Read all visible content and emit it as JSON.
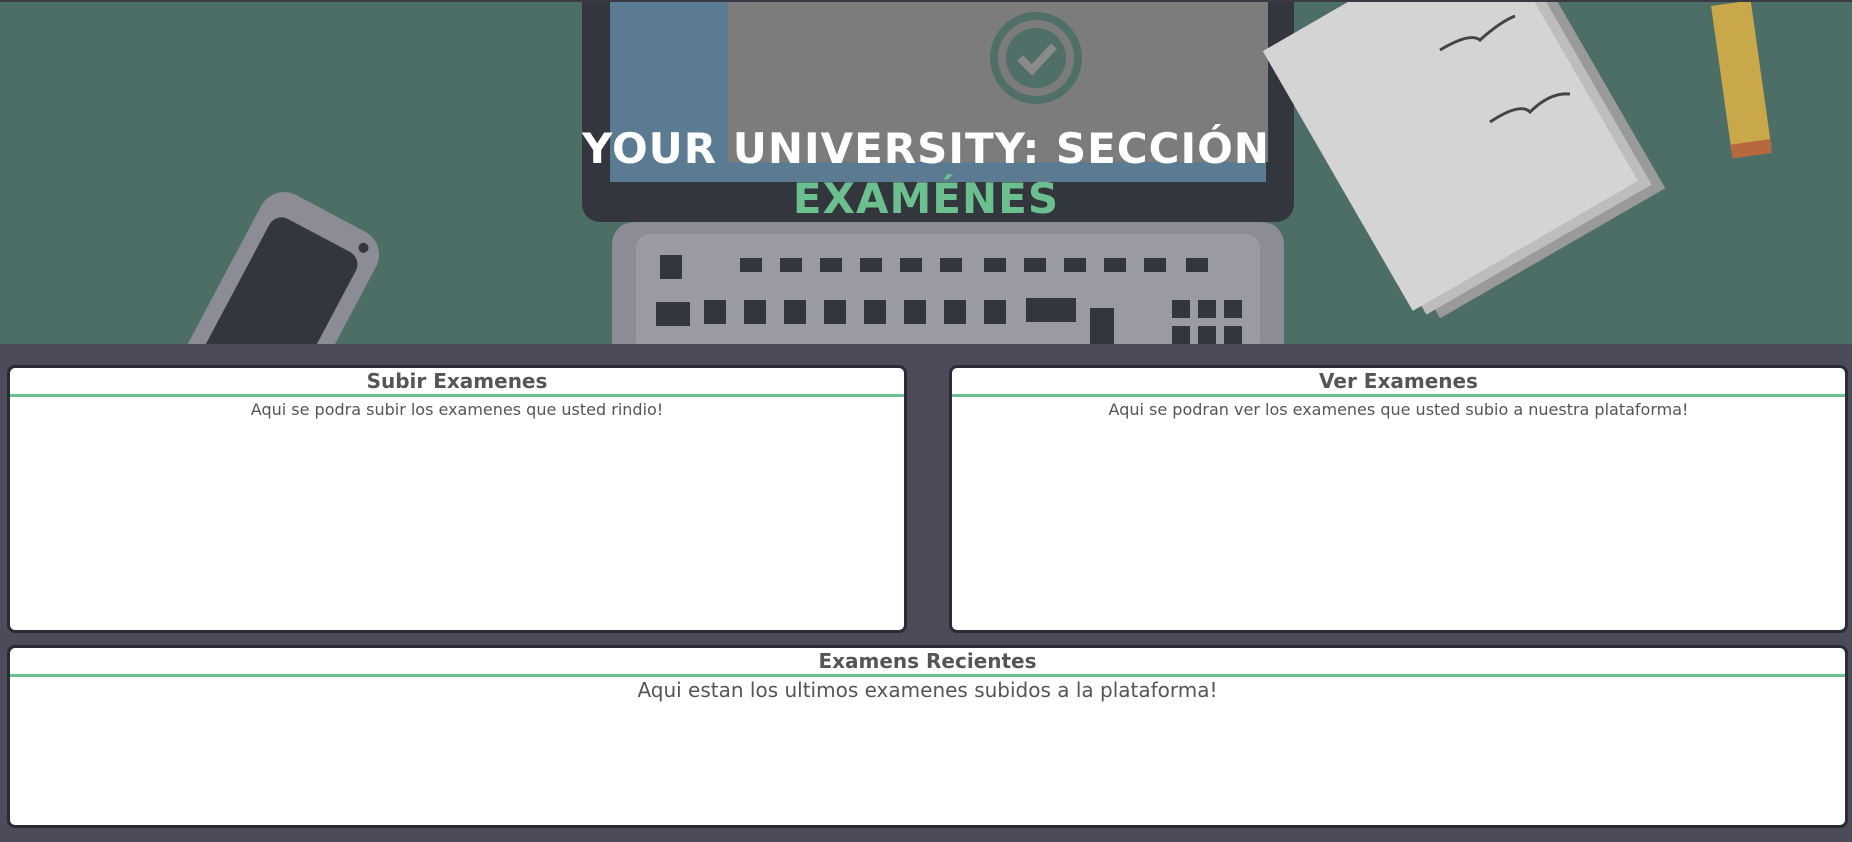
{
  "hero": {
    "title_line1": "YOUR UNIVERSITY: SECCIÓN",
    "title_line2": "EXAMÉNES"
  },
  "panels": {
    "subir": {
      "title": "Subir Examenes",
      "description": "Aqui se podra subir los examenes que usted rindio!"
    },
    "ver": {
      "title": "Ver Examenes",
      "description": "Aqui se podran ver los examenes que usted subio a nuestra plataforma!"
    },
    "recientes": {
      "title": "Examens Recientes",
      "description": "Aqui estan los ultimos examenes subidos a la plataforma!"
    }
  },
  "colors": {
    "accent": "#6cc08f",
    "page_background": "#4b4b5a",
    "hero_background": "#4d6e66"
  }
}
